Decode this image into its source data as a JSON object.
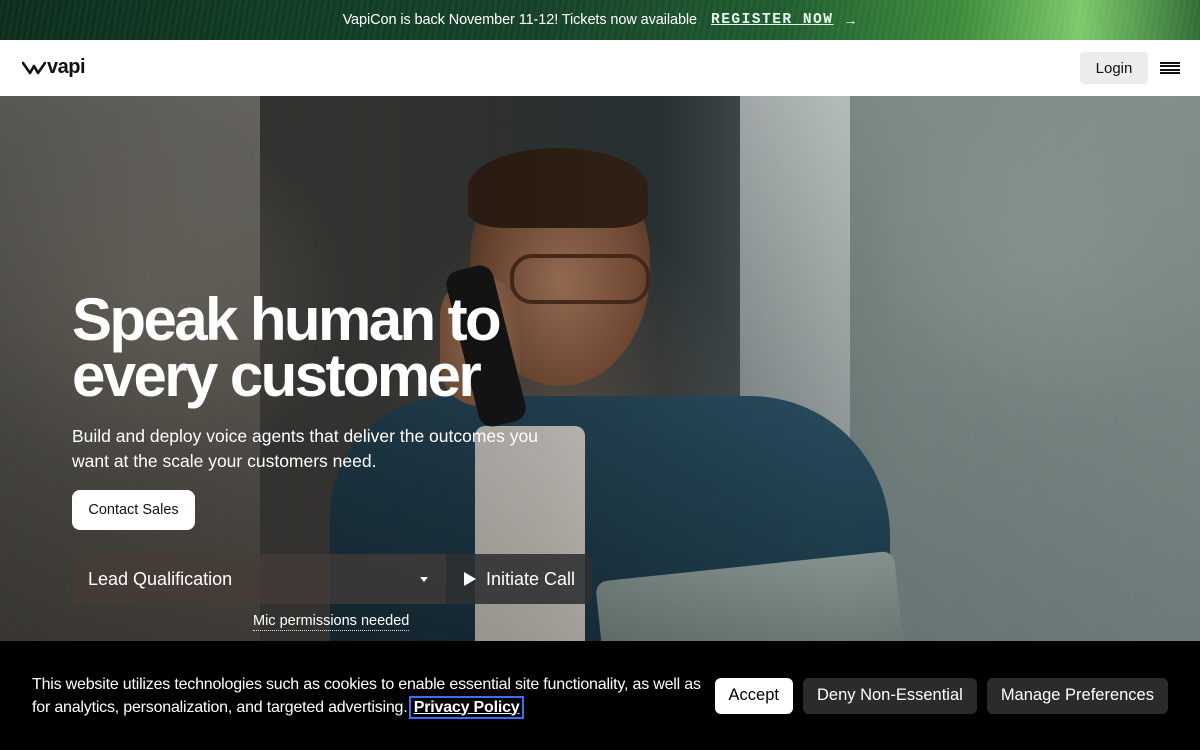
{
  "announcement": {
    "text": "VapiCon is back November 11-12! Tickets now available",
    "link_label": "REGISTER NOW",
    "arrow": "→"
  },
  "nav": {
    "logo_text": "vapi",
    "login_label": "Login",
    "menu_icon": "hamburger-menu-icon"
  },
  "hero": {
    "headline": "Speak human to every customer",
    "subheadline": "Build and deploy voice agents that deliver the outcomes you want at the scale your customers need.",
    "contact_label": "Contact Sales",
    "demo_select_value": "Lead Qualification",
    "initiate_call_label": "Initiate Call",
    "mic_note": "Mic permissions needed"
  },
  "cookie_banner": {
    "text": "This website utilizes technologies such as cookies to enable essential site functionality, as well as for analytics, personalization, and targeted advertising.",
    "privacy_label": "Privacy Policy",
    "accept_label": "Accept",
    "deny_label": "Deny Non-Essential",
    "manage_label": "Manage Preferences"
  },
  "colors": {
    "accent_green": "#3c8a3a",
    "nav_bg": "#ffffff",
    "cookie_bg": "#000000",
    "focus_outline": "#3b6cff"
  }
}
